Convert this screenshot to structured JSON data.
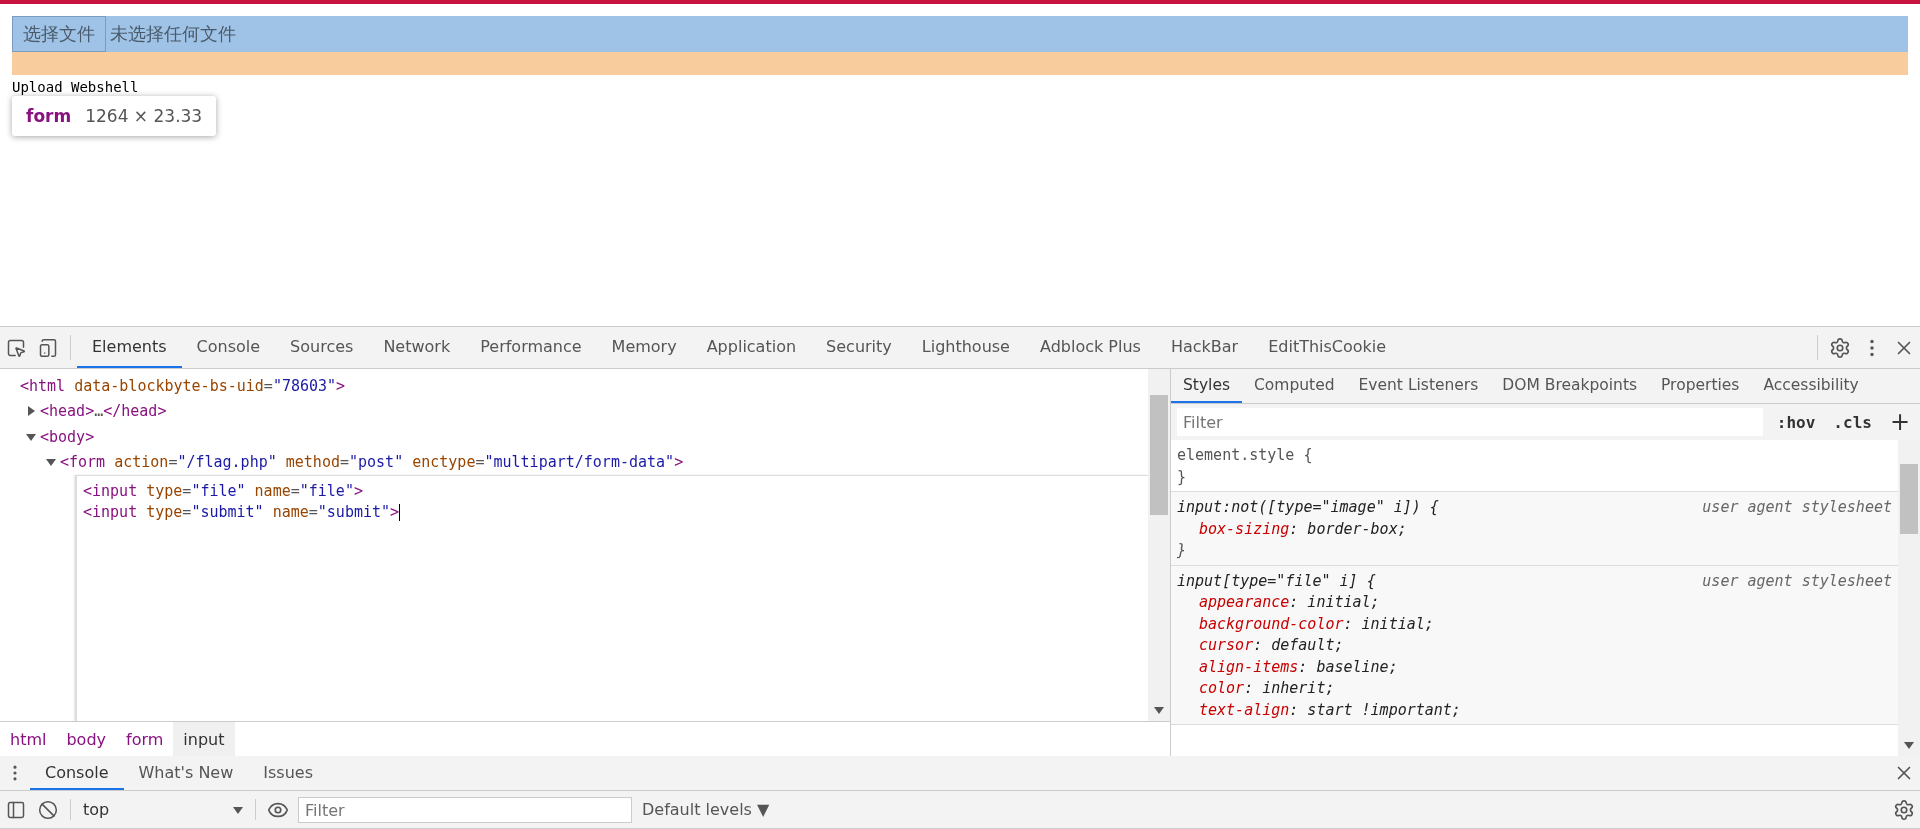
{
  "page": {
    "file_button": "选择文件",
    "file_status": "未选择任何文件",
    "text": "Upload Webshell",
    "tooltip": {
      "tag": "form",
      "size": "1264 × 23.33"
    }
  },
  "devtools": {
    "tabs": [
      {
        "label": "Elements",
        "selected": true
      },
      {
        "label": "Console",
        "selected": false
      },
      {
        "label": "Sources",
        "selected": false
      },
      {
        "label": "Network",
        "selected": false
      },
      {
        "label": "Performance",
        "selected": false
      },
      {
        "label": "Memory",
        "selected": false
      },
      {
        "label": "Application",
        "selected": false
      },
      {
        "label": "Security",
        "selected": false
      },
      {
        "label": "Lighthouse",
        "selected": false
      },
      {
        "label": "Adblock Plus",
        "selected": false
      },
      {
        "label": "HackBar",
        "selected": false
      },
      {
        "label": "EditThisCookie",
        "selected": false
      }
    ],
    "dom": {
      "tokens": [
        {
          "kind": "tag",
          "text": "<html"
        },
        {
          "kind": "attr",
          "text": " data-blockbyte-bs-uid"
        },
        {
          "kind": "eq",
          "text": "="
        },
        {
          "kind": "val",
          "text": "\"78603\""
        },
        {
          "kind": "tag",
          "text": ">"
        }
      ],
      "children": [
        {
          "expanded": false,
          "tokens": [
            {
              "kind": "tag",
              "text": "<head>"
            },
            {
              "kind": "eq",
              "text": "…"
            },
            {
              "kind": "tag",
              "text": "</head>"
            }
          ]
        },
        {
          "expanded": true,
          "tokens": [
            {
              "kind": "tag",
              "text": "<body>"
            }
          ],
          "children": [
            {
              "expanded": true,
              "tokens": [
                {
                  "kind": "tag",
                  "text": "<form"
                },
                {
                  "kind": "attr",
                  "text": " action"
                },
                {
                  "kind": "eq",
                  "text": "="
                },
                {
                  "kind": "val",
                  "text": "\"/flag.php\""
                },
                {
                  "kind": "attr",
                  "text": " method"
                },
                {
                  "kind": "eq",
                  "text": "="
                },
                {
                  "kind": "val",
                  "text": "\"post\""
                },
                {
                  "kind": "attr",
                  "text": " enctype"
                },
                {
                  "kind": "eq",
                  "text": "="
                },
                {
                  "kind": "val",
                  "text": "\"multipart/form-data\""
                },
                {
                  "kind": "tag",
                  "text": ">"
                }
              ],
              "edit_lines": [
                [
                  {
                    "kind": "tag",
                    "text": "<input"
                  },
                  {
                    "kind": "attr",
                    "text": " type"
                  },
                  {
                    "kind": "eq",
                    "text": "="
                  },
                  {
                    "kind": "val",
                    "text": "\"file\""
                  },
                  {
                    "kind": "attr",
                    "text": " name"
                  },
                  {
                    "kind": "eq",
                    "text": "="
                  },
                  {
                    "kind": "val",
                    "text": "\"file\""
                  },
                  {
                    "kind": "tag",
                    "text": ">"
                  }
                ],
                [
                  {
                    "kind": "tag",
                    "text": "<input"
                  },
                  {
                    "kind": "attr",
                    "text": " type"
                  },
                  {
                    "kind": "eq",
                    "text": "="
                  },
                  {
                    "kind": "val",
                    "text": "\"submit\""
                  },
                  {
                    "kind": "attr",
                    "text": " name"
                  },
                  {
                    "kind": "eq",
                    "text": "="
                  },
                  {
                    "kind": "val",
                    "text": "\"submit\""
                  },
                  {
                    "kind": "tag",
                    "text": ">"
                  }
                ]
              ]
            }
          ]
        }
      ]
    },
    "breadcrumbs": [
      {
        "label": "html",
        "selected": false
      },
      {
        "label": "body",
        "selected": false
      },
      {
        "label": "form",
        "selected": false
      },
      {
        "label": "input",
        "selected": true
      }
    ],
    "styles": {
      "tabs": [
        {
          "label": "Styles",
          "selected": true
        },
        {
          "label": "Computed",
          "selected": false
        },
        {
          "label": "Event Listeners",
          "selected": false
        },
        {
          "label": "DOM Breakpoints",
          "selected": false
        },
        {
          "label": "Properties",
          "selected": false
        },
        {
          "label": "Accessibility",
          "selected": false
        }
      ],
      "filter_placeholder": "Filter",
      "hov": ":hov",
      "cls": ".cls",
      "add": "+",
      "rules": [
        {
          "kind": "inline",
          "selector": "element.style {",
          "close": "}"
        },
        {
          "kind": "agent",
          "selector": "input:not([type=\"image\" i]) {",
          "source": "user agent stylesheet",
          "close": "}",
          "declarations": [
            {
              "prop": "box-sizing",
              "value": ": border-box;"
            }
          ]
        },
        {
          "kind": "agent",
          "selector": "input[type=\"file\" i] {",
          "source": "user agent stylesheet",
          "declarations": [
            {
              "prop": "appearance",
              "value": ": initial;"
            },
            {
              "prop": "background-color",
              "value": ": initial;"
            },
            {
              "prop": "cursor",
              "value": ": default;"
            },
            {
              "prop": "align-items",
              "value": ": baseline;"
            },
            {
              "prop": "color",
              "value": ": inherit;"
            },
            {
              "prop": "text-align",
              "value": ": start !important;"
            }
          ]
        }
      ]
    }
  },
  "drawer": {
    "tabs": [
      {
        "label": "Console",
        "selected": true
      },
      {
        "label": "What's New",
        "selected": false
      },
      {
        "label": "Issues",
        "selected": false
      }
    ],
    "context": "top",
    "filter_placeholder": "Filter",
    "levels": "Default levels ▼"
  }
}
